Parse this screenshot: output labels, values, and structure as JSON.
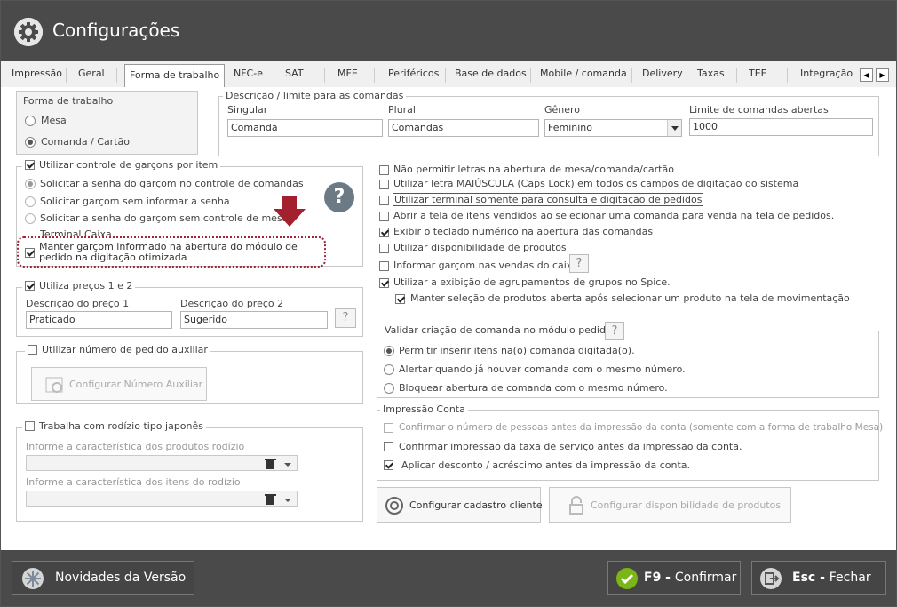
{
  "window": {
    "title": "Configurações"
  },
  "tabs": [
    {
      "label": "Impressão"
    },
    {
      "label": "Geral"
    },
    {
      "label": "Forma de trabalho"
    },
    {
      "label": "NFC-e"
    },
    {
      "label": "SAT"
    },
    {
      "label": "MFE"
    },
    {
      "label": "Periféricos"
    },
    {
      "label": "Base de dados"
    },
    {
      "label": "Mobile / comanda"
    },
    {
      "label": "Delivery"
    },
    {
      "label": "Taxas"
    },
    {
      "label": "TEF"
    },
    {
      "label": "Integração"
    }
  ],
  "tab_scroll": {
    "left": "◀",
    "right": "▶"
  },
  "forma_trabalho": {
    "title": "Forma de trabalho",
    "options": [
      {
        "label": "Mesa",
        "selected": false
      },
      {
        "label": "Comanda / Cartão",
        "selected": true
      }
    ]
  },
  "descricao_limite": {
    "title": "Descrição / limite para as comandas",
    "singular_label": "Singular",
    "singular_value": "Comanda",
    "plural_label": "Plural",
    "plural_value": "Comandas",
    "genero_label": "Gênero",
    "genero_value": "Feminino",
    "limite_label": "Limite de comandas abertas",
    "limite_value": "1000"
  },
  "garcons": {
    "title": "Utilizar controle de garçons por item",
    "checked": true,
    "options": [
      {
        "label": "Solicitar a senha do garçom no controle de comandas",
        "selected": true
      },
      {
        "label": "Solicitar garçom sem informar a senha",
        "selected": false
      },
      {
        "label": "Solicitar a senha do garçom sem controle de mesa",
        "selected": false
      }
    ],
    "terminal_caixa": "Terminal Caixa",
    "manter_label": "Manter garçom informado na abertura do módulo de pedido na digitação otimizada",
    "manter_checked": true,
    "help": "?"
  },
  "precos": {
    "title": "Utiliza preços 1 e 2",
    "checked": true,
    "preco1_label": "Descrição do preço 1",
    "preco1_value": "Praticado",
    "preco2_label": "Descrição do preço 2",
    "preco2_value": "Sugerido",
    "help": "?"
  },
  "pedido_aux": {
    "title": "Utilizar número de pedido auxiliar",
    "checked": false,
    "button": "Configurar Número Auxiliar"
  },
  "rodizio": {
    "title": "Trabalha com rodízio tipo japonês",
    "checked": false,
    "produtos_label": "Informe a característica dos produtos rodízio",
    "itens_label": "Informe a característica dos itens do rodízio"
  },
  "opcoes": [
    {
      "label": "Não permitir letras na abertura de mesa/comanda/cartão",
      "checked": false
    },
    {
      "label": "Utilizar letra MAIÚSCULA (Caps Lock) em todos os campos de digitação do sistema",
      "checked": false
    },
    {
      "label": "Utilizar terminal somente para consulta e digitação de pedidos",
      "checked": false
    },
    {
      "label": "Abrir a tela de itens vendidos ao selecionar uma comanda para venda na tela de pedidos.",
      "checked": false
    },
    {
      "label": "Exibir o teclado numérico na abertura das comandas",
      "checked": true
    },
    {
      "label": "Utilizar disponibilidade de produtos",
      "checked": false
    },
    {
      "label": "Informar garçom nas vendas do caixa",
      "checked": false
    },
    {
      "label": "Utilizar a exibição de agrupamentos de grupos no Spice.",
      "checked": true
    }
  ],
  "manter_selecao": {
    "label": "Manter seleção de produtos aberta após selecionar um produto na tela de movimentação",
    "checked": true
  },
  "help_q": "?",
  "validar": {
    "title": "Validar criação de comanda no módulo pedido",
    "options": [
      {
        "label": "Permitir inserir itens na(o) comanda digitada(o).",
        "selected": true
      },
      {
        "label": "Alertar quando já houver comanda com o mesmo número.",
        "selected": false
      },
      {
        "label": "Bloquear abertura de comanda com o mesmo número.",
        "selected": false
      }
    ]
  },
  "impressao": {
    "title": "Impressão Conta",
    "options": [
      {
        "label": "Confirmar o número de pessoas antes da impressão da conta (somente com a forma de trabalho Mesa)",
        "checked": false,
        "disabled": true
      },
      {
        "label": "Confirmar impressão da taxa de serviço antes da impressão da conta.",
        "checked": false,
        "disabled": false
      },
      {
        "label": "Aplicar desconto / acréscimo antes da impressão da conta.",
        "checked": true,
        "disabled": false
      }
    ]
  },
  "buttons": {
    "cadastro_cliente": "Configurar cadastro cliente",
    "disponibilidade": "Configurar disponibilidade de produtos"
  },
  "footer": {
    "novidades": "Novidades da Versão",
    "confirm_key": "F9",
    "confirm_label": "Confirmar",
    "close_key": "Esc",
    "close_label": "Fechar",
    "sep": " - "
  },
  "colors": {
    "titlebar": "#4a4a4a",
    "accent_arrow": "#a3202e",
    "confirm_icon": "#7cb518"
  }
}
